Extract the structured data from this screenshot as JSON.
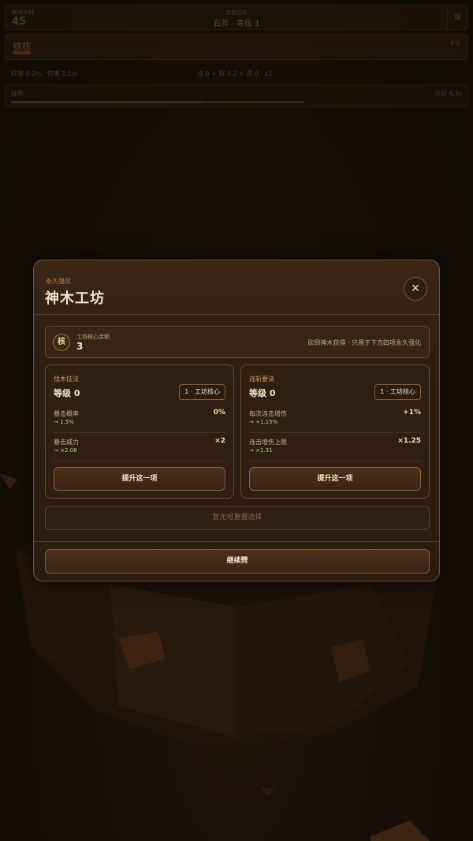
{
  "hud": {
    "resource_label": "获得木料",
    "resource_value": "45",
    "target_label": "当前目标",
    "target_value": "石斧 · 等级 1",
    "side_button": "设"
  },
  "weapon": {
    "name": "铁栋",
    "percent_text": "4%",
    "progress_fraction": 0.04
  },
  "stats": {
    "left": "砍速 0.2/s · 伤害 1.1/s",
    "right": "点 0 + 斩 0.2 + 灵 0 · x1"
  },
  "rage": {
    "name": "狂热",
    "cooldown": "冷却 4.3s",
    "progress_fraction": 0.65
  },
  "modal": {
    "subtitle": "永久强化",
    "title": "神木工坊",
    "close_symbol": "✕",
    "core": {
      "icon_text": "核",
      "label": "工坊核心余额",
      "count": "3",
      "note": "砍倒神木获得 · 只用于下方四项永久强化"
    },
    "cards": [
      {
        "name": "伐木技法",
        "level": "等级 0",
        "cost": "1 · 工坊核心",
        "stats": [
          {
            "name": "暴击概率",
            "next": "→ 1.5%",
            "value": "0%"
          },
          {
            "name": "暴击威力",
            "next": "→ ×2.08",
            "value": "×2"
          }
        ],
        "button": "提升这一项"
      },
      {
        "name": "连斩要诀",
        "level": "等级 0",
        "cost": "1 · 工坊核心",
        "stats": [
          {
            "name": "每次连击增伤",
            "next": "→ +1.15%",
            "value": "+1%"
          },
          {
            "name": "连击增伤上限",
            "next": "→ ×1.31",
            "value": "×1.25"
          }
        ],
        "button": "提升这一项"
      }
    ],
    "reset_button": "暂无可重置选择",
    "continue_button": "继续劈"
  }
}
